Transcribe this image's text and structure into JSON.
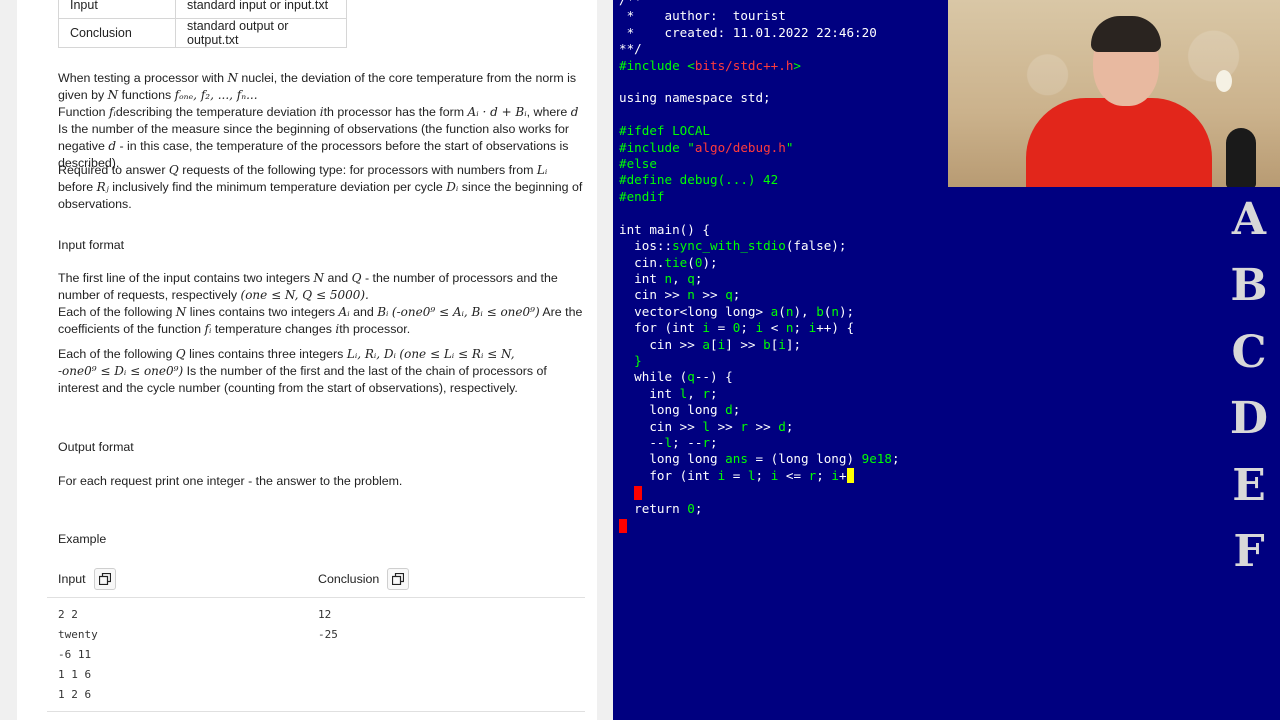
{
  "io_table": {
    "rows": [
      {
        "label": "Input",
        "value": "standard input or input.txt"
      },
      {
        "label": "Conclusion",
        "value": "standard output or output.txt"
      }
    ]
  },
  "statement": {
    "p1_a": "When testing a processor with",
    "p1_b": "nuclei, the deviation of the core temperature from the norm is given by",
    "p1_c": "functions",
    "p1_d": "Function",
    "p1_e": "describing the temperature deviation",
    "p1_f": "processor has the form",
    "p1_g": ", where",
    "p1_h": "Is the number of the measure since the beginning of observations (the function also works for negative",
    "p1_i": "- in this case, the temperature of the processors before the start of observations is described).",
    "p2_a": "Required to answer",
    "p2_b": "requests of the following type: for processors with numbers from",
    "p2_c": "before",
    "p2_d": "inclusively find the minimum temperature deviation per cycle",
    "p2_e": "since the beginning of observations.",
    "input_format_heading": "Input format",
    "p3_a": "The first line of the input contains two integers",
    "p3_b": "and",
    "p3_c": "- the number of processors and the number of requests, respectively",
    "p3_d": "Each of the following",
    "p3_e": "lines contains two integers",
    "p3_f": "and",
    "p3_g": "Are the coefficients of the function",
    "p3_h": "temperature changes",
    "p3_i": "processor.",
    "p4_a": "Each of the following",
    "p4_b": "lines contains three integers",
    "p4_c": "Is the number of the first and the last of the chain of processors of interest and the cycle number (counting from the start of observations), respectively.",
    "output_format_heading": "Output format",
    "p5": "For each request print one integer - the answer to the problem.",
    "example_heading": "Example",
    "math": {
      "N": "N",
      "Q": "Q",
      "funcs": "fₒₙₑ, f₂, ..., fₙ...",
      "fi": "fᵢ",
      "ith": "i",
      "form": "Aᵢ · d + Bᵢ",
      "d": "d",
      "Li": "Lᵢ",
      "Rj": "Rⱼ",
      "Di": "Dᵢ",
      "range1": "(one ≤ N, Q ≤ 5000).",
      "Ai": "Aᵢ",
      "Bi": "Bᵢ",
      "range2": "(-one0⁹ ≤ Aᵢ, Bᵢ ≤ one0⁹)",
      "triple": "Lᵢ, Rᵢ, Dᵢ",
      "range3a": "(one ≤ Lᵢ ≤ Rᵢ ≤ N,",
      "range3b": "-one0⁹ ≤ Dᵢ ≤ one0⁹)"
    }
  },
  "example": {
    "input_label": "Input",
    "output_label": "Conclusion",
    "input_lines": [
      "2 2",
      "twenty",
      "-6 11",
      "1 1 6",
      "1 2 6"
    ],
    "output_lines": [
      "12",
      "-25"
    ]
  },
  "editor": {
    "lines": [
      "/**",
      " *    author:  tourist",
      " *    created: 11.01.2022 22:46:20",
      "**/",
      "#include <bits/stdc++.h>",
      "",
      "using namespace std;",
      "",
      "#ifdef LOCAL",
      "#include \"algo/debug.h\"",
      "#else",
      "#define debug(...) 42",
      "#endif",
      "",
      "int main() {",
      "  ios::sync_with_stdio(false);",
      "  cin.tie(0);",
      "  int n, q;",
      "  cin >> n >> q;",
      "  vector<long long> a(n), b(n);",
      "  for (int i = 0; i < n; i++) {",
      "    cin >> a[i] >> b[i];",
      "  }",
      "  while (q--) {",
      "    int l, r;",
      "    long long d;",
      "    cin >> l >> r >> d;",
      "    --l; --r;",
      "    long long ans = (long long) 9e18;",
      "    for (int i = l; i <= r; i+",
      "",
      "  return 0;",
      ""
    ]
  },
  "problem_letters": [
    "A",
    "B",
    "C",
    "D",
    "E",
    "F"
  ],
  "colors": {
    "editor_bg": "#000080",
    "code_green": "#00ff00",
    "code_red": "#ff3b3b",
    "cursor_yellow": "#ffff00"
  }
}
